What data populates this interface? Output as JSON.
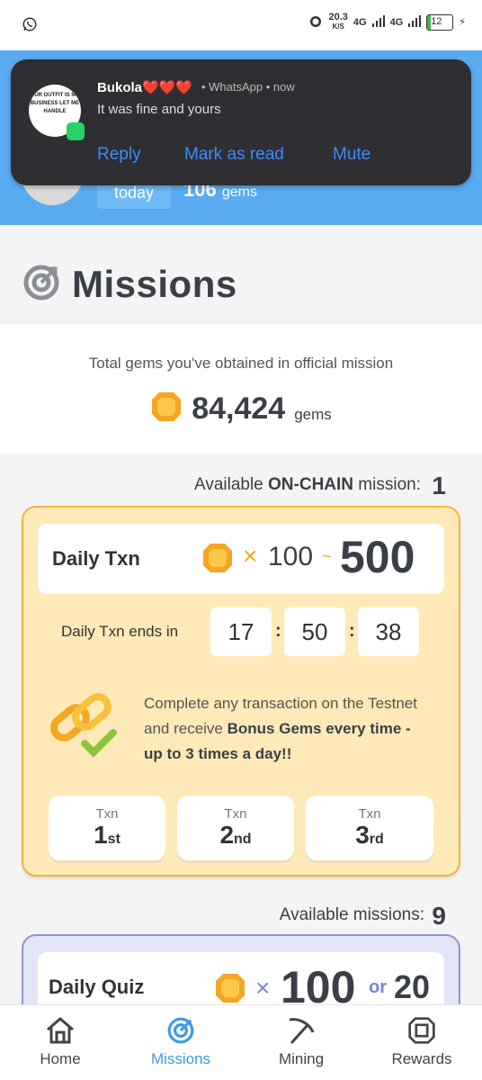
{
  "status_bar": {
    "net_speed": "20.3",
    "net_unit": "K/S",
    "signal1": "4G",
    "signal2": "4G",
    "battery": "12"
  },
  "notification": {
    "sender": "Bukola❤️❤️❤️",
    "app_time": "• WhatsApp • now",
    "message": "It was fine and yours",
    "avatar_text": "OUR OUTFIT IS MY BUSINESS LET ME HANDLE",
    "actions": [
      "Reply",
      "Mark as read",
      "Mute"
    ]
  },
  "header": {
    "today_label": "today",
    "today_gems": "106",
    "gems_unit": "gems"
  },
  "missions": {
    "title": "Missions",
    "total_label": "Total gems you've obtained in official mission",
    "total_value": "84,424",
    "total_unit": "gems"
  },
  "onchain": {
    "label_prefix": "Available ",
    "label_bold": "ON-CHAIN",
    "label_suffix": " mission:",
    "count": "1",
    "card": {
      "title": "Daily Txn",
      "multiplier": "×",
      "min": "100",
      "tilde": "~",
      "max": "500",
      "ends_label": "Daily Txn ends in",
      "hours": "17",
      "minutes": "50",
      "seconds": "38",
      "desc_plain": "Complete any transaction on the Testnet and receive ",
      "desc_bold": "Bonus Gems every time - up to 3 times a day!!",
      "txn_label": "Txn",
      "txns": [
        {
          "num": "1",
          "suffix": "st"
        },
        {
          "num": "2",
          "suffix": "nd"
        },
        {
          "num": "3",
          "suffix": "rd"
        }
      ]
    }
  },
  "available": {
    "label": "Available missions:",
    "count": "9",
    "quiz": {
      "title": "Daily Quiz",
      "multiplier": "×",
      "a": "100",
      "or": "or",
      "b": "20"
    }
  },
  "nav": {
    "items": [
      {
        "label": "Home",
        "icon": "home-icon"
      },
      {
        "label": "Missions",
        "icon": "target-icon",
        "active": true
      },
      {
        "label": "Mining",
        "icon": "pickaxe-icon"
      },
      {
        "label": "Rewards",
        "icon": "gem-icon"
      }
    ]
  },
  "colors": {
    "header_blue": "#5aabf0",
    "onchain_card": "#ffe9b8",
    "onchain_border": "#f2b53a",
    "quiz_card": "#e2e4f7",
    "accent_active": "#3b9be8",
    "notification_link": "#3d8cf5"
  }
}
